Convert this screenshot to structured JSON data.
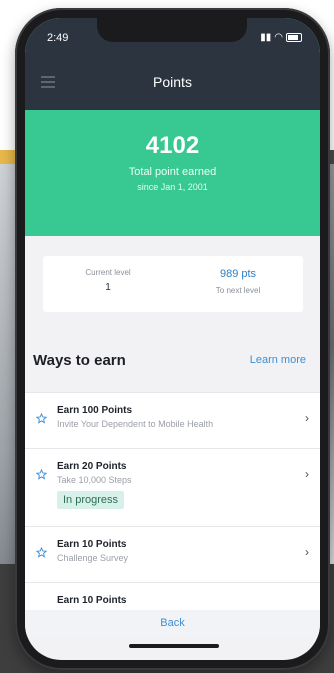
{
  "status_bar": {
    "time": "2:49"
  },
  "nav": {
    "title": "Points"
  },
  "points": {
    "value": "4102",
    "label": "Total point earned",
    "since": "since Jan 1, 2001"
  },
  "level": {
    "current_label": "Current level",
    "current_value": "1",
    "next_points": "989 pts",
    "next_label": "To next level"
  },
  "ways": {
    "title": "Ways to earn",
    "learn_more": "Learn more",
    "items": [
      {
        "title": "Earn 100 Points",
        "desc": "Invite Your Dependent to Mobile Health",
        "badge": ""
      },
      {
        "title": "Earn 20 Points",
        "desc": "Take 10,000 Steps",
        "badge": "In progress"
      },
      {
        "title": "Earn 10 Points",
        "desc": "Challenge Survey",
        "badge": ""
      },
      {
        "title": "Earn 10 Points",
        "desc": "",
        "badge": ""
      }
    ]
  },
  "back": {
    "label": "Back"
  },
  "colors": {
    "header_green": "#37c991",
    "nav_dark": "#2c3440",
    "accent_blue": "#3b8fd6"
  },
  "icons": [
    "menu-icon",
    "star-icon",
    "chevron-right-icon",
    "wifi-icon",
    "signal-icon",
    "battery-icon"
  ]
}
